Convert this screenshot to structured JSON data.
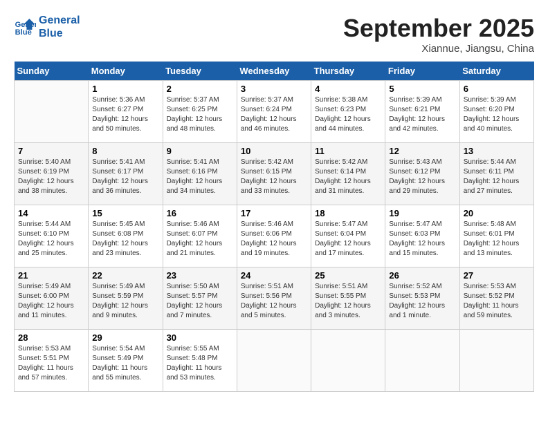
{
  "logo": {
    "line1": "General",
    "line2": "Blue"
  },
  "title": "September 2025",
  "subtitle": "Xiannue, Jiangsu, China",
  "days_of_week": [
    "Sunday",
    "Monday",
    "Tuesday",
    "Wednesday",
    "Thursday",
    "Friday",
    "Saturday"
  ],
  "weeks": [
    [
      {
        "day": "",
        "info": ""
      },
      {
        "day": "1",
        "info": "Sunrise: 5:36 AM\nSunset: 6:27 PM\nDaylight: 12 hours\nand 50 minutes."
      },
      {
        "day": "2",
        "info": "Sunrise: 5:37 AM\nSunset: 6:25 PM\nDaylight: 12 hours\nand 48 minutes."
      },
      {
        "day": "3",
        "info": "Sunrise: 5:37 AM\nSunset: 6:24 PM\nDaylight: 12 hours\nand 46 minutes."
      },
      {
        "day": "4",
        "info": "Sunrise: 5:38 AM\nSunset: 6:23 PM\nDaylight: 12 hours\nand 44 minutes."
      },
      {
        "day": "5",
        "info": "Sunrise: 5:39 AM\nSunset: 6:21 PM\nDaylight: 12 hours\nand 42 minutes."
      },
      {
        "day": "6",
        "info": "Sunrise: 5:39 AM\nSunset: 6:20 PM\nDaylight: 12 hours\nand 40 minutes."
      }
    ],
    [
      {
        "day": "7",
        "info": "Sunrise: 5:40 AM\nSunset: 6:19 PM\nDaylight: 12 hours\nand 38 minutes."
      },
      {
        "day": "8",
        "info": "Sunrise: 5:41 AM\nSunset: 6:17 PM\nDaylight: 12 hours\nand 36 minutes."
      },
      {
        "day": "9",
        "info": "Sunrise: 5:41 AM\nSunset: 6:16 PM\nDaylight: 12 hours\nand 34 minutes."
      },
      {
        "day": "10",
        "info": "Sunrise: 5:42 AM\nSunset: 6:15 PM\nDaylight: 12 hours\nand 33 minutes."
      },
      {
        "day": "11",
        "info": "Sunrise: 5:42 AM\nSunset: 6:14 PM\nDaylight: 12 hours\nand 31 minutes."
      },
      {
        "day": "12",
        "info": "Sunrise: 5:43 AM\nSunset: 6:12 PM\nDaylight: 12 hours\nand 29 minutes."
      },
      {
        "day": "13",
        "info": "Sunrise: 5:44 AM\nSunset: 6:11 PM\nDaylight: 12 hours\nand 27 minutes."
      }
    ],
    [
      {
        "day": "14",
        "info": "Sunrise: 5:44 AM\nSunset: 6:10 PM\nDaylight: 12 hours\nand 25 minutes."
      },
      {
        "day": "15",
        "info": "Sunrise: 5:45 AM\nSunset: 6:08 PM\nDaylight: 12 hours\nand 23 minutes."
      },
      {
        "day": "16",
        "info": "Sunrise: 5:46 AM\nSunset: 6:07 PM\nDaylight: 12 hours\nand 21 minutes."
      },
      {
        "day": "17",
        "info": "Sunrise: 5:46 AM\nSunset: 6:06 PM\nDaylight: 12 hours\nand 19 minutes."
      },
      {
        "day": "18",
        "info": "Sunrise: 5:47 AM\nSunset: 6:04 PM\nDaylight: 12 hours\nand 17 minutes."
      },
      {
        "day": "19",
        "info": "Sunrise: 5:47 AM\nSunset: 6:03 PM\nDaylight: 12 hours\nand 15 minutes."
      },
      {
        "day": "20",
        "info": "Sunrise: 5:48 AM\nSunset: 6:01 PM\nDaylight: 12 hours\nand 13 minutes."
      }
    ],
    [
      {
        "day": "21",
        "info": "Sunrise: 5:49 AM\nSunset: 6:00 PM\nDaylight: 12 hours\nand 11 minutes."
      },
      {
        "day": "22",
        "info": "Sunrise: 5:49 AM\nSunset: 5:59 PM\nDaylight: 12 hours\nand 9 minutes."
      },
      {
        "day": "23",
        "info": "Sunrise: 5:50 AM\nSunset: 5:57 PM\nDaylight: 12 hours\nand 7 minutes."
      },
      {
        "day": "24",
        "info": "Sunrise: 5:51 AM\nSunset: 5:56 PM\nDaylight: 12 hours\nand 5 minutes."
      },
      {
        "day": "25",
        "info": "Sunrise: 5:51 AM\nSunset: 5:55 PM\nDaylight: 12 hours\nand 3 minutes."
      },
      {
        "day": "26",
        "info": "Sunrise: 5:52 AM\nSunset: 5:53 PM\nDaylight: 12 hours\nand 1 minute."
      },
      {
        "day": "27",
        "info": "Sunrise: 5:53 AM\nSunset: 5:52 PM\nDaylight: 11 hours\nand 59 minutes."
      }
    ],
    [
      {
        "day": "28",
        "info": "Sunrise: 5:53 AM\nSunset: 5:51 PM\nDaylight: 11 hours\nand 57 minutes."
      },
      {
        "day": "29",
        "info": "Sunrise: 5:54 AM\nSunset: 5:49 PM\nDaylight: 11 hours\nand 55 minutes."
      },
      {
        "day": "30",
        "info": "Sunrise: 5:55 AM\nSunset: 5:48 PM\nDaylight: 11 hours\nand 53 minutes."
      },
      {
        "day": "",
        "info": ""
      },
      {
        "day": "",
        "info": ""
      },
      {
        "day": "",
        "info": ""
      },
      {
        "day": "",
        "info": ""
      }
    ]
  ]
}
